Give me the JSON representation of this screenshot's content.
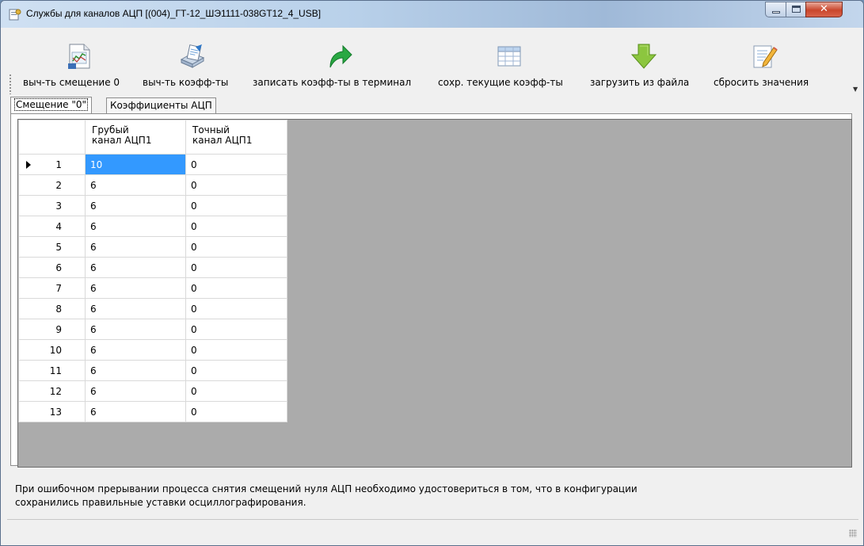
{
  "window": {
    "title": "Службы для каналов АЦП   [(004)_ГТ-12_ШЭ1111-038GT12_4_USB]"
  },
  "toolbar": {
    "buttons": [
      {
        "label": "выч-ть смещение 0",
        "icon": "calc-offset-icon"
      },
      {
        "label": "выч-ть коэфф-ты",
        "icon": "calc-coefficients-icon"
      },
      {
        "label": "записать коэфф-ты в терминал",
        "icon": "write-arrow-icon"
      },
      {
        "label": "сохр. текущие коэфф-ты",
        "icon": "table-save-icon"
      },
      {
        "label": "загрузить из файла",
        "icon": "download-arrow-icon"
      },
      {
        "label": "сбросить значения",
        "icon": "edit-reset-icon"
      }
    ]
  },
  "tabs": [
    {
      "label": "Смещение \"0\"",
      "active": true
    },
    {
      "label": "Коэффициенты АЦП",
      "active": false
    }
  ],
  "grid": {
    "columns": [
      {
        "line1": "Грубый",
        "line2": "канал АЦП1"
      },
      {
        "line1": "Точный",
        "line2": "канал АЦП1"
      }
    ],
    "rows": [
      {
        "index": "1",
        "coarse": "10",
        "fine": "0",
        "current": true
      },
      {
        "index": "2",
        "coarse": "6",
        "fine": "0"
      },
      {
        "index": "3",
        "coarse": "6",
        "fine": "0"
      },
      {
        "index": "4",
        "coarse": "6",
        "fine": "0"
      },
      {
        "index": "5",
        "coarse": "6",
        "fine": "0"
      },
      {
        "index": "6",
        "coarse": "6",
        "fine": "0"
      },
      {
        "index": "7",
        "coarse": "6",
        "fine": "0"
      },
      {
        "index": "8",
        "coarse": "6",
        "fine": "0"
      },
      {
        "index": "9",
        "coarse": "6",
        "fine": "0"
      },
      {
        "index": "10",
        "coarse": "6",
        "fine": "0"
      },
      {
        "index": "11",
        "coarse": "6",
        "fine": "0"
      },
      {
        "index": "12",
        "coarse": "6",
        "fine": "0"
      },
      {
        "index": "13",
        "coarse": "6",
        "fine": "0"
      }
    ]
  },
  "note": "При ошибочном прерывании процесса снятия смещений нуля АЦП необходимо удостовериться в том, что в конфигурации\nсохранились правильные уставки осциллографирования.",
  "colors": {
    "selection": "#3399ff",
    "grid_background": "#ababab",
    "close_button": "#c9462c"
  }
}
